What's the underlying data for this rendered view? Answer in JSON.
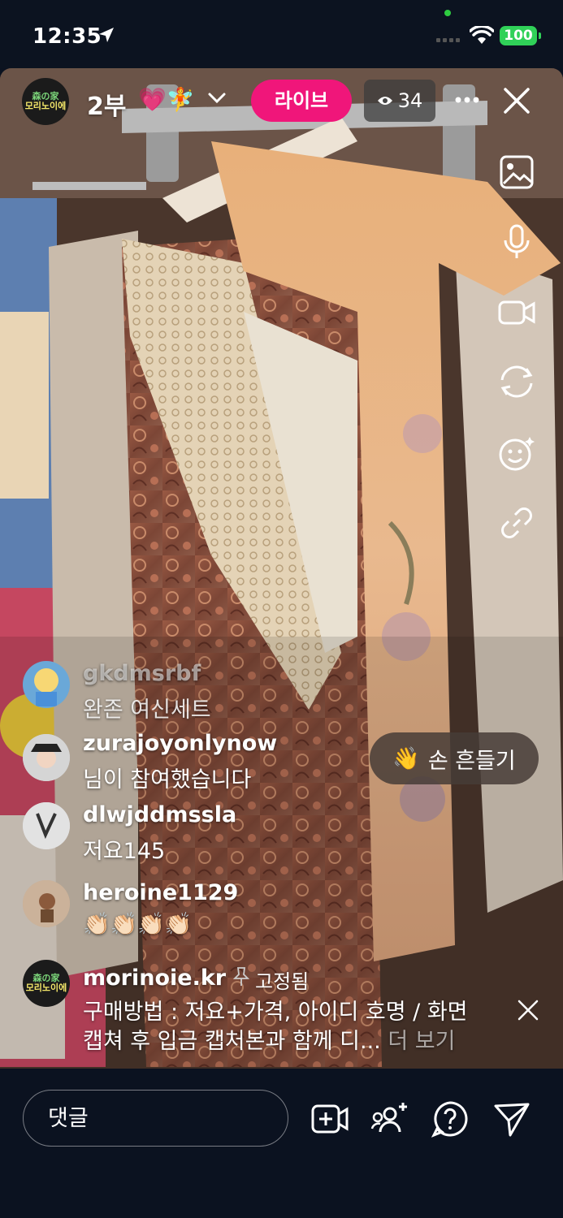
{
  "status_bar": {
    "time": "12:35",
    "battery": "100"
  },
  "live": {
    "host_logo": {
      "line1": "森の家",
      "line2": "모리노이에"
    },
    "title": "2부",
    "title_emoji": "💗🧚",
    "live_label": "라이브",
    "viewer_count": "34"
  },
  "comments": [
    {
      "user": "gkdmsrbf",
      "text": "완존 여신세트",
      "faded": true
    },
    {
      "user": "zurajoyonlynow",
      "text": "님이 참여했습니다"
    },
    {
      "user": "dlwjddmssla",
      "text": "저요145"
    },
    {
      "user": "heroine1129",
      "text": "👏🏻👏🏻👏🏻👏🏻"
    }
  ],
  "wave_button": {
    "emoji": "👋",
    "label": "손 흔들기"
  },
  "pinned": {
    "user": "morinoie.kr",
    "tag": "고정됨",
    "line1": "구매방법 : 저요+가격, 아이디 호명 / 화면",
    "line2": "캡쳐 후 입금 캡처본과 함께 디...",
    "more": "더 보기"
  },
  "composer": {
    "placeholder": "댓글"
  },
  "colors": {
    "live_badge": "#f0167a",
    "battery": "#30d158",
    "background": "#0b1220"
  },
  "icons": {
    "rail": [
      "gallery-icon",
      "microphone-icon",
      "video-camera-icon",
      "flip-camera-icon",
      "effects-icon",
      "link-icon"
    ],
    "bottom": [
      "add-video-icon",
      "invite-guest-icon",
      "question-icon",
      "share-icon"
    ]
  }
}
